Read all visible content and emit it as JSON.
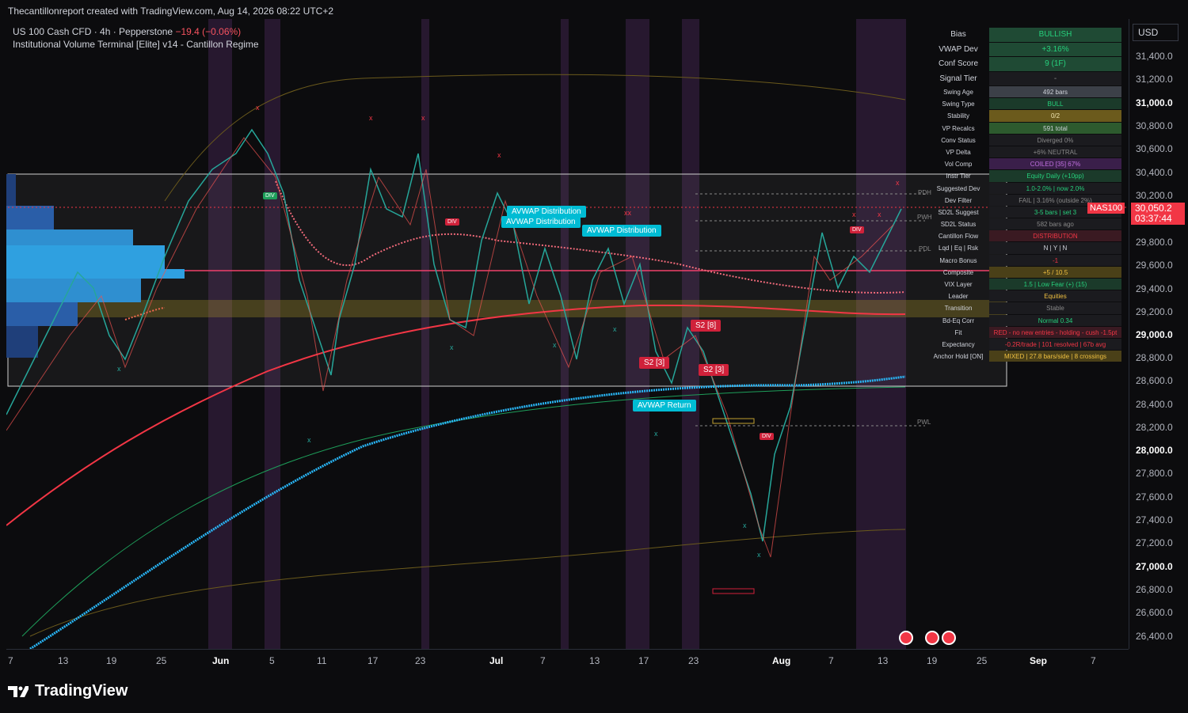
{
  "header": {
    "attribution": "Thecantillonreport created with TradingView.com, Aug 14, 2026 08:22 UTC+2"
  },
  "legend": {
    "symbol": "US 100 Cash CFD · 4h · Pepperstone",
    "change": "−19.4 (−0.06%)",
    "indicator": "Institutional Volume Terminal [Elite] v14 - Cantillon Regime"
  },
  "price_axis": {
    "currency": "USD",
    "labels": [
      "31,400.0",
      "31,200.0",
      "31,000.0",
      "30,800.0",
      "30,600.0",
      "30,400.0",
      "30,200.0",
      "29,800.0",
      "29,600.0",
      "29,400.0",
      "29,200.0",
      "29,000.0",
      "28,800.0",
      "28,600.0",
      "28,400.0",
      "28,200.0",
      "28,000.0",
      "27,800.0",
      "27,600.0",
      "27,400.0",
      "27,200.0",
      "27,000.0",
      "26,800.0",
      "26,600.0",
      "26,400.0"
    ],
    "bold_labels": [
      "31,000.0",
      "29,000.0",
      "28,000.0",
      "27,000.0"
    ],
    "symbol_tag": "NAS100",
    "current_price": "30,050.2",
    "countdown": "03:37:44"
  },
  "time_axis": {
    "labels": [
      "7",
      "13",
      "19",
      "25",
      "Jun",
      "5",
      "11",
      "17",
      "23",
      "Jul",
      "7",
      "13",
      "17",
      "23",
      "Aug",
      "7",
      "13",
      "19",
      "25",
      "Sep",
      "7"
    ],
    "bold_labels": [
      "Jun",
      "Jul",
      "Aug",
      "Sep"
    ]
  },
  "chart_labels": {
    "avwap_dist_1": "AVWAP Distribution",
    "avwap_dist_2": "AVWAP Distribution",
    "avwap_dist_3": "AVWAP Distribution",
    "avwap_return": "AVWAP Return",
    "s2_1": "S2 [3]",
    "s2_2": "S2 [3]",
    "s2_3": "S2 [8]",
    "div": "DIV",
    "pdh": "PDH",
    "pwh": "PWH",
    "pdl": "PDL",
    "pwl": "PWL"
  },
  "stats_table": [
    {
      "key": "Bias",
      "value": "BULLISH",
      "bg": "#1f4a34",
      "fg": "#26d07c",
      "big": true
    },
    {
      "key": "VWAP Dev",
      "value": "+3.16%",
      "bg": "#1f4a34",
      "fg": "#26d07c",
      "big": true
    },
    {
      "key": "Conf Score",
      "value": "9 (1F)",
      "bg": "#1f4a34",
      "fg": "#26d07c",
      "big": true
    },
    {
      "key": "Signal Tier",
      "value": "-",
      "bg": "#1b1b1f",
      "fg": "#888888",
      "big": true
    },
    {
      "key": "Swing Age",
      "value": "492 bars",
      "bg": "#3c4048",
      "fg": "#d1d4dc",
      "big": false
    },
    {
      "key": "Swing Type",
      "value": "BULL",
      "bg": "#1b3a2a",
      "fg": "#26d07c",
      "big": false
    },
    {
      "key": "Stability",
      "value": "0/2",
      "bg": "#6b5a1c",
      "fg": "#f0e6b0",
      "big": false
    },
    {
      "key": "VP Recalcs",
      "value": "591 total",
      "bg": "#2d5a2e",
      "fg": "#d1d4dc",
      "big": false
    },
    {
      "key": "Conv Status",
      "value": "Diverged 0%",
      "bg": "#1b1b1f",
      "fg": "#888888",
      "big": false
    },
    {
      "key": "VP Delta",
      "value": "+6% NEUTRAL",
      "bg": "#1b1b1f",
      "fg": "#888888",
      "big": false
    },
    {
      "key": "Vol Comp",
      "value": "COILED [35] 67%",
      "bg": "#3a1f4a",
      "fg": "#c070e0",
      "big": false
    },
    {
      "key": "Instr Tier",
      "value": "Equity Daily (+10pp)",
      "bg": "#1b3a2a",
      "fg": "#26d07c",
      "big": false
    },
    {
      "key": "Suggested Dev",
      "value": "1.0-2.0% | now 2.0%",
      "bg": "#1b1b1f",
      "fg": "#26d07c",
      "big": false
    },
    {
      "key": "Dev Filter",
      "value": "FAIL | 3.16% (outside 2%)",
      "bg": "#1b1b1f",
      "fg": "#888888",
      "big": false
    },
    {
      "key": "SD2L Suggest",
      "value": "3-5 bars | set 3",
      "bg": "#1b1b1f",
      "fg": "#26d07c",
      "big": false
    },
    {
      "key": "SD2L Status",
      "value": "582 bars ago",
      "bg": "#1b1b1f",
      "fg": "#888888",
      "big": false
    },
    {
      "key": "Cantillon Flow",
      "value": "DISTRIBUTION",
      "bg": "#3a1a22",
      "fg": "#f23645",
      "big": false
    },
    {
      "key": "Lqd | Eq | Rsk",
      "value": "N | Y | N",
      "bg": "#1b1b1f",
      "fg": "#d1d4dc",
      "big": false
    },
    {
      "key": "Macro Bonus",
      "value": "-1",
      "bg": "#1b1b1f",
      "fg": "#f23645",
      "big": false
    },
    {
      "key": "Composite",
      "value": "+5 / 10.5",
      "bg": "#4a4018",
      "fg": "#f0c040",
      "big": false
    },
    {
      "key": "VIX Layer",
      "value": "1.5 | Low Fear (+) (15)",
      "bg": "#1b3a2a",
      "fg": "#26d07c",
      "big": false
    },
    {
      "key": "Leader",
      "value": "Equities",
      "bg": "#1b1b1f",
      "fg": "#f0c040",
      "big": false
    },
    {
      "key": "Transition",
      "value": "Stable",
      "bg": "#1b1b1f",
      "fg": "#888888",
      "big": false
    },
    {
      "key": "Bd-Eq Corr",
      "value": "Normal 0.34",
      "bg": "#1b1b1f",
      "fg": "#26d07c",
      "big": false
    },
    {
      "key": "Fit",
      "value": "RED - no new entries - holding - cush -1.5pt",
      "bg": "#3a1a22",
      "fg": "#f23645",
      "big": false
    },
    {
      "key": "Expectancy",
      "value": "-0.2R/trade | 101 resolved | 67b avg",
      "bg": "#1b1b1f",
      "fg": "#f23645",
      "big": false
    },
    {
      "key": "Anchor Hold [ON]",
      "value": "MIXED | 27.8 bars/side | 8 crossings",
      "bg": "#4a4018",
      "fg": "#f0c040",
      "big": false
    }
  ],
  "footer": {
    "brand": "TradingView"
  }
}
